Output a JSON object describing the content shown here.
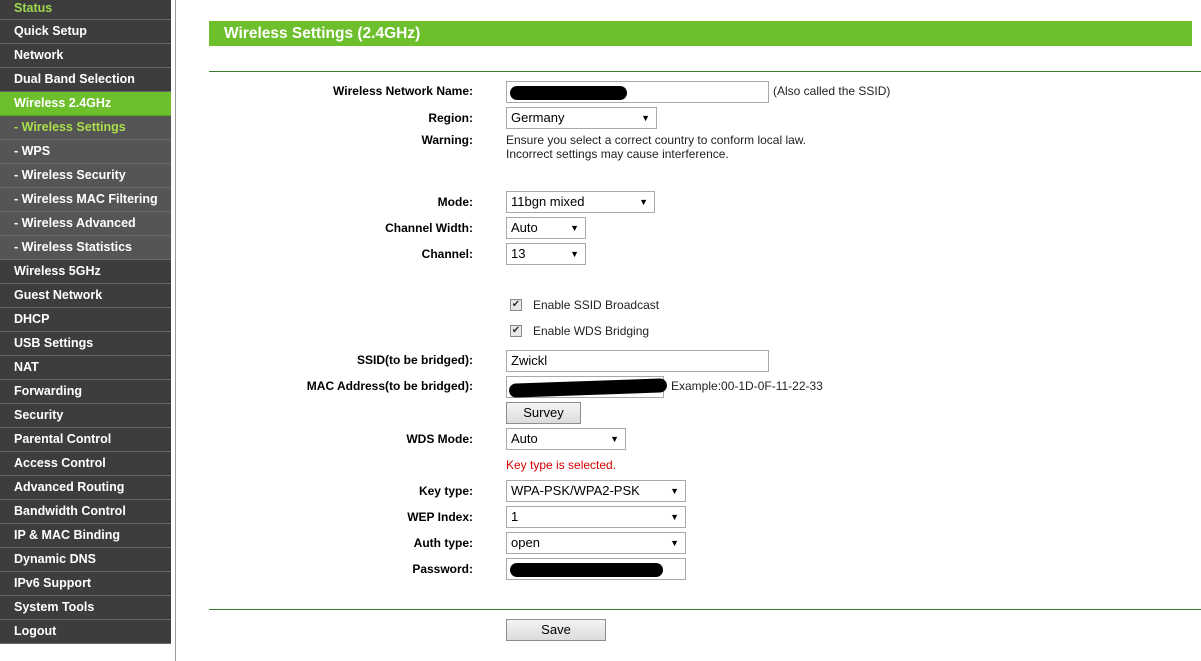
{
  "sidebar": {
    "items": [
      {
        "label": "Status"
      },
      {
        "label": "Quick Setup"
      },
      {
        "label": "Network"
      },
      {
        "label": "Dual Band Selection"
      },
      {
        "label": "Wireless 2.4GHz"
      },
      {
        "label": "- Wireless Settings"
      },
      {
        "label": "- WPS"
      },
      {
        "label": "- Wireless Security"
      },
      {
        "label": "- Wireless MAC Filtering"
      },
      {
        "label": "- Wireless Advanced"
      },
      {
        "label": "- Wireless Statistics"
      },
      {
        "label": "Wireless 5GHz"
      },
      {
        "label": "Guest Network"
      },
      {
        "label": "DHCP"
      },
      {
        "label": "USB Settings"
      },
      {
        "label": "NAT"
      },
      {
        "label": "Forwarding"
      },
      {
        "label": "Security"
      },
      {
        "label": "Parental Control"
      },
      {
        "label": "Access Control"
      },
      {
        "label": "Advanced Routing"
      },
      {
        "label": "Bandwidth Control"
      },
      {
        "label": "IP & MAC Binding"
      },
      {
        "label": "Dynamic DNS"
      },
      {
        "label": "IPv6 Support"
      },
      {
        "label": "System Tools"
      },
      {
        "label": "Logout"
      }
    ]
  },
  "page": {
    "title": "Wireless Settings (2.4GHz)"
  },
  "form": {
    "ssid_label": "Wireless Network Name:",
    "ssid_value": "",
    "ssid_hint": "(Also called the SSID)",
    "region_label": "Region:",
    "region_value": "Germany",
    "warning_label": "Warning:",
    "warning_line1": "Ensure you select a correct country to conform local law.",
    "warning_line2": "Incorrect settings may cause interference.",
    "mode_label": "Mode:",
    "mode_value": "11bgn mixed",
    "width_label": "Channel Width:",
    "width_value": "Auto",
    "channel_label": "Channel:",
    "channel_value": "13",
    "ssid_broadcast_label": "Enable SSID Broadcast",
    "ssid_broadcast_checked": true,
    "wds_label": "Enable WDS Bridging",
    "wds_checked": true,
    "bridge_ssid_label": "SSID(to be bridged):",
    "bridge_ssid_value": "Zwickl",
    "bridge_mac_label": "MAC Address(to be bridged):",
    "bridge_mac_value": "",
    "mac_example": "Example:00-1D-0F-11-22-33",
    "survey_label": "Survey",
    "wds_mode_label": "WDS Mode:",
    "wds_mode_value": "Auto",
    "key_status": "Key type is selected.",
    "key_type_label": "Key type:",
    "key_type_value": "WPA-PSK/WPA2-PSK",
    "wep_index_label": "WEP Index:",
    "wep_index_value": "1",
    "auth_type_label": "Auth type:",
    "auth_type_value": "open",
    "password_label": "Password:",
    "password_value": "",
    "save_label": "Save"
  },
  "colors": {
    "accent_green": "#6ebf2c",
    "sidebar_bg": "#3d3d3d",
    "sub_active_text": "#a8df4a",
    "error_red": "#d40000"
  }
}
